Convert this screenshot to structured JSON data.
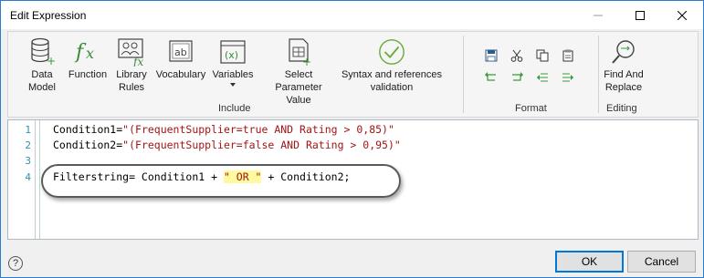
{
  "window": {
    "title": "Edit Expression"
  },
  "ribbon": {
    "include_buttons": [
      {
        "label": "Data\nModel",
        "icon": "data-model-icon"
      },
      {
        "label": "Function",
        "icon": "function-fx-icon"
      },
      {
        "label": "Library\nRules",
        "icon": "library-rules-icon"
      },
      {
        "label": "Vocabulary",
        "icon": "vocabulary-icon"
      },
      {
        "label": "Variables",
        "icon": "variables-icon"
      },
      {
        "label": "Select Parameter\nValue",
        "icon": "select-parameter-icon"
      },
      {
        "label": "Syntax and references\nvalidation",
        "icon": "validation-check-icon"
      }
    ],
    "include_group_label": "Include",
    "format_group_label": "Format",
    "find_replace_label": "Find And\nReplace",
    "editing_group_label": "Editing"
  },
  "editor": {
    "line_numbers": [
      "1",
      "2",
      "3",
      "4"
    ],
    "lines": [
      {
        "plain": "Condition1=",
        "string": "\"(FrequentSupplier=true AND Rating > 0,85)\""
      },
      {
        "plain": "Condition2=",
        "string": "\"(FrequentSupplier=false AND Rating > 0,95)\""
      },
      {
        "plain": "",
        "string": ""
      },
      {
        "pre": "Filterstring= Condition1 + ",
        "highlight": "\" OR \"",
        "post": " + Condition2;"
      }
    ]
  },
  "footer": {
    "help_label": "?",
    "ok_label": "OK",
    "cancel_label": "Cancel"
  }
}
